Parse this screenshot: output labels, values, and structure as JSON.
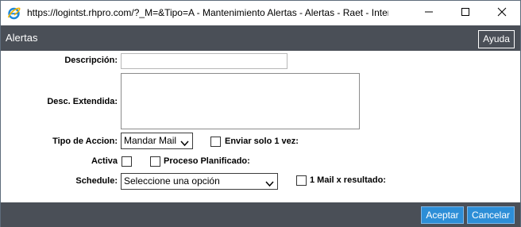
{
  "window": {
    "title": "https://logintst.rhpro.com/?_M=&Tipo=A - Mantenimiento Alertas - Alertas - Raet - Inter..."
  },
  "header": {
    "title": "Alertas",
    "help_label": "Ayuda"
  },
  "form": {
    "descripcion_label": "Descripción:",
    "descripcion_value": "",
    "desc_extendida_label": "Desc. Extendida:",
    "desc_extendida_value": "",
    "tipo_accion_label": "Tipo de Accion:",
    "tipo_accion_value": "Mandar Mail",
    "enviar_solo_label": "Enviar solo 1 vez:",
    "activa_label": "Activa",
    "proceso_planificado_label": "Proceso Planificado:",
    "schedule_label": "Schedule:",
    "schedule_value": "Seleccione una opción",
    "mail_resultado_label": "1 Mail x resultado:"
  },
  "footer": {
    "accept_label": "Aceptar",
    "cancel_label": "Cancelar"
  },
  "colors": {
    "header_bg": "#4a4f57",
    "button_blue": "#2d8ed7"
  },
  "icons": {
    "browser": "internet-explorer-icon",
    "minimize": "minimize-icon",
    "maximize": "maximize-icon",
    "close": "close-icon",
    "dropdown": "chevron-down-icon"
  }
}
